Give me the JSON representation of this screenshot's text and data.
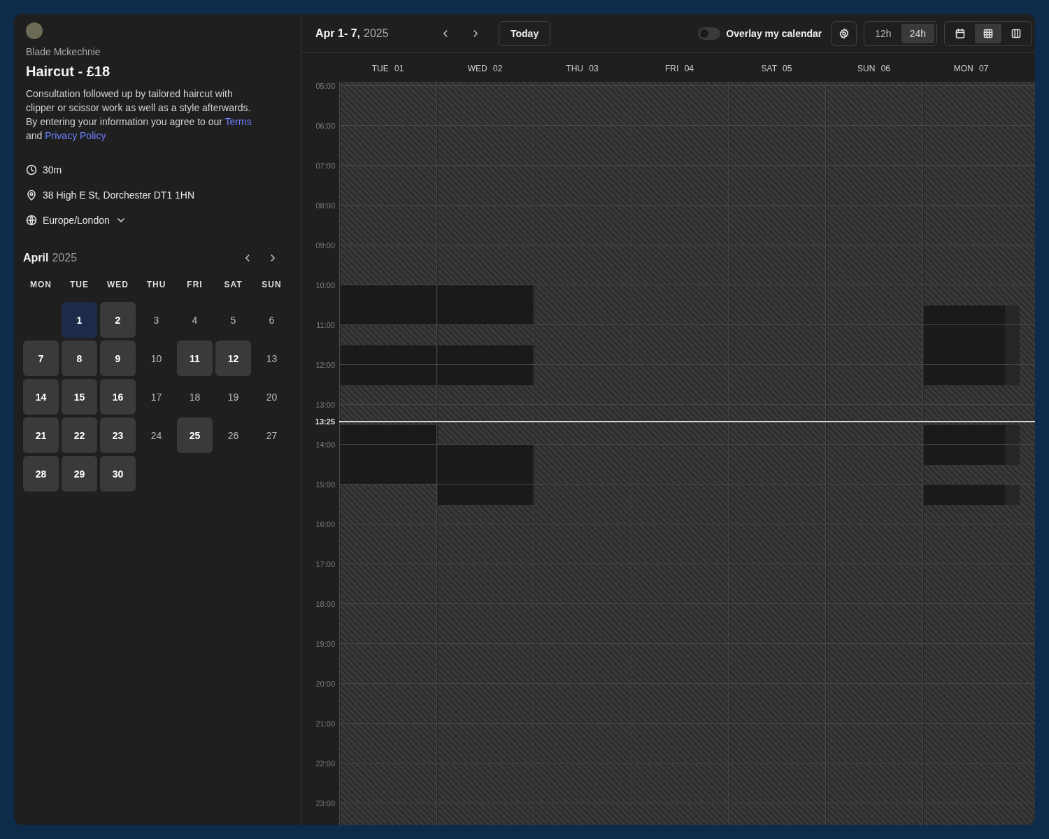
{
  "event": {
    "host": "Blade Mckechnie",
    "title": "Haircut - £18",
    "description": "Consultation followed up by tailored haircut with clipper or scissor work as well as a style afterwards. By entering your information you agree to our ",
    "terms_link": "Terms",
    "joiner": " and ",
    "privacy_link": "Privacy Policy",
    "duration": "30m",
    "location": "38 High E St, Dorchester DT1 1HN",
    "timezone": "Europe/London"
  },
  "mini_calendar": {
    "month": "April",
    "year": "2025",
    "weekdays": [
      "MON",
      "TUE",
      "WED",
      "THU",
      "FRI",
      "SAT",
      "SUN"
    ],
    "days": [
      {
        "kind": "blank"
      },
      {
        "kind": "day",
        "label": "1",
        "available": true,
        "selected": true
      },
      {
        "kind": "day",
        "label": "2",
        "available": true,
        "selected": false
      },
      {
        "kind": "day",
        "label": "3",
        "available": false,
        "selected": false
      },
      {
        "kind": "day",
        "label": "4",
        "available": false,
        "selected": false
      },
      {
        "kind": "day",
        "label": "5",
        "available": false,
        "selected": false
      },
      {
        "kind": "day",
        "label": "6",
        "available": false,
        "selected": false
      },
      {
        "kind": "day",
        "label": "7",
        "available": true,
        "selected": false
      },
      {
        "kind": "day",
        "label": "8",
        "available": true,
        "selected": false
      },
      {
        "kind": "day",
        "label": "9",
        "available": true,
        "selected": false
      },
      {
        "kind": "day",
        "label": "10",
        "available": false,
        "selected": false
      },
      {
        "kind": "day",
        "label": "11",
        "available": true,
        "selected": false
      },
      {
        "kind": "day",
        "label": "12",
        "available": true,
        "selected": false
      },
      {
        "kind": "day",
        "label": "13",
        "available": false,
        "selected": false
      },
      {
        "kind": "day",
        "label": "14",
        "available": true,
        "selected": false
      },
      {
        "kind": "day",
        "label": "15",
        "available": true,
        "selected": false
      },
      {
        "kind": "day",
        "label": "16",
        "available": true,
        "selected": false
      },
      {
        "kind": "day",
        "label": "17",
        "available": false,
        "selected": false
      },
      {
        "kind": "day",
        "label": "18",
        "available": false,
        "selected": false
      },
      {
        "kind": "day",
        "label": "19",
        "available": false,
        "selected": false
      },
      {
        "kind": "day",
        "label": "20",
        "available": false,
        "selected": false
      },
      {
        "kind": "day",
        "label": "21",
        "available": true,
        "selected": false
      },
      {
        "kind": "day",
        "label": "22",
        "available": true,
        "selected": false
      },
      {
        "kind": "day",
        "label": "23",
        "available": true,
        "selected": false
      },
      {
        "kind": "day",
        "label": "24",
        "available": false,
        "selected": false
      },
      {
        "kind": "day",
        "label": "25",
        "available": true,
        "selected": false
      },
      {
        "kind": "day",
        "label": "26",
        "available": false,
        "selected": false
      },
      {
        "kind": "day",
        "label": "27",
        "available": false,
        "selected": false
      },
      {
        "kind": "day",
        "label": "28",
        "available": true,
        "selected": false
      },
      {
        "kind": "day",
        "label": "29",
        "available": true,
        "selected": false
      },
      {
        "kind": "day",
        "label": "30",
        "available": true,
        "selected": false
      }
    ]
  },
  "toolbar": {
    "range": "Apr 1- 7,",
    "year": "2025",
    "today_button": "Today",
    "overlay": {
      "label": "Overlay my calendar",
      "on": false
    },
    "time_format": [
      {
        "label": "12h",
        "selected": false
      },
      {
        "label": "24h",
        "selected": true
      }
    ],
    "views": [
      {
        "kind": "month",
        "selected": false
      },
      {
        "kind": "week",
        "selected": true
      },
      {
        "kind": "column",
        "selected": false
      }
    ]
  },
  "week": {
    "days": [
      {
        "label": "TUE 01",
        "half_hours": [
          false,
          false,
          false,
          false,
          false,
          false,
          false,
          false,
          false,
          false,
          true,
          true,
          false,
          true,
          true,
          false,
          false,
          true,
          true,
          true,
          false,
          false,
          false,
          false,
          false,
          false,
          false,
          false,
          false,
          false,
          false,
          false,
          false,
          false,
          false,
          false,
          false,
          false
        ]
      },
      {
        "label": "WED 02",
        "half_hours": [
          false,
          false,
          false,
          false,
          false,
          false,
          false,
          false,
          false,
          false,
          true,
          true,
          false,
          true,
          true,
          false,
          false,
          false,
          true,
          true,
          true,
          false,
          false,
          false,
          false,
          false,
          false,
          false,
          false,
          false,
          false,
          false,
          false,
          false,
          false,
          false,
          false,
          false
        ]
      },
      {
        "label": "THU 03",
        "half_hours": [
          false,
          false,
          false,
          false,
          false,
          false,
          false,
          false,
          false,
          false,
          false,
          false,
          false,
          false,
          false,
          false,
          false,
          false,
          false,
          false,
          false,
          false,
          false,
          false,
          false,
          false,
          false,
          false,
          false,
          false,
          false,
          false,
          false,
          false,
          false,
          false,
          false,
          false
        ]
      },
      {
        "label": "FRI 04",
        "half_hours": [
          false,
          false,
          false,
          false,
          false,
          false,
          false,
          false,
          false,
          false,
          false,
          false,
          false,
          false,
          false,
          false,
          false,
          false,
          false,
          false,
          false,
          false,
          false,
          false,
          false,
          false,
          false,
          false,
          false,
          false,
          false,
          false,
          false,
          false,
          false,
          false,
          false,
          false
        ]
      },
      {
        "label": "SAT 05",
        "half_hours": [
          false,
          false,
          false,
          false,
          false,
          false,
          false,
          false,
          false,
          false,
          false,
          false,
          false,
          false,
          false,
          false,
          false,
          false,
          false,
          false,
          false,
          false,
          false,
          false,
          false,
          false,
          false,
          false,
          false,
          false,
          false,
          false,
          false,
          false,
          false,
          false,
          false,
          false
        ]
      },
      {
        "label": "SUN 06",
        "half_hours": [
          false,
          false,
          false,
          false,
          false,
          false,
          false,
          false,
          false,
          false,
          false,
          false,
          false,
          false,
          false,
          false,
          false,
          false,
          false,
          false,
          false,
          false,
          false,
          false,
          false,
          false,
          false,
          false,
          false,
          false,
          false,
          false,
          false,
          false,
          false,
          false,
          false,
          false
        ]
      },
      {
        "label": "MON 07",
        "half_hours": [
          false,
          false,
          false,
          false,
          false,
          false,
          false,
          false,
          false,
          false,
          false,
          true,
          true,
          true,
          true,
          false,
          false,
          true,
          true,
          false,
          true,
          false,
          false,
          false,
          false,
          false,
          false,
          false,
          false,
          false,
          false,
          false,
          false,
          false,
          false,
          false,
          false,
          false
        ]
      }
    ],
    "hours": [
      "05:00",
      "06:00",
      "07:00",
      "08:00",
      "09:00",
      "10:00",
      "11:00",
      "12:00",
      "13:00",
      "14:00",
      "15:00",
      "16:00",
      "17:00",
      "18:00",
      "19:00",
      "20:00",
      "21:00",
      "22:00",
      "23:00"
    ],
    "now": "13:25"
  }
}
